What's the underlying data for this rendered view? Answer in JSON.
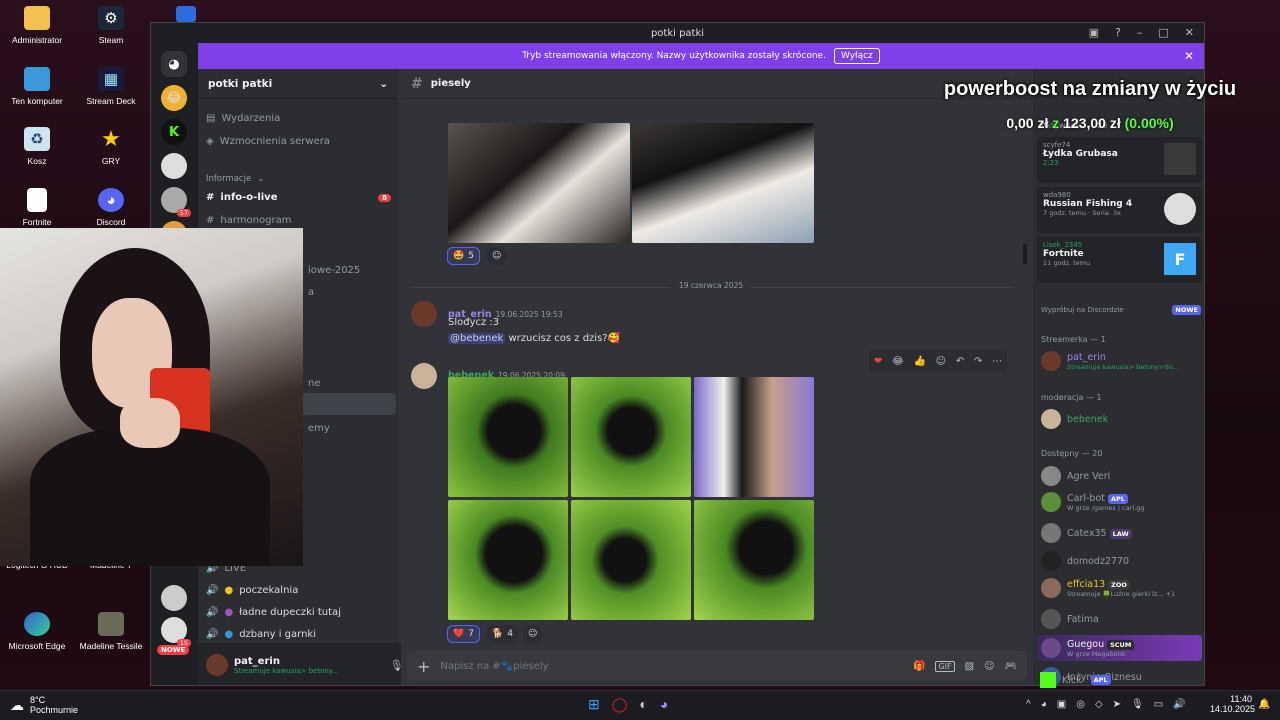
{
  "desktop": {
    "icons": [
      {
        "label": "Administrator",
        "icon": "folder-icon"
      },
      {
        "label": "Steam",
        "icon": "steam-icon"
      },
      {
        "label": "Ten komputer",
        "icon": "computer-icon"
      },
      {
        "label": "Stream Deck",
        "icon": "streamdeck-icon"
      },
      {
        "label": "Kosz",
        "icon": "recycle-bin-icon"
      },
      {
        "label": "GRY",
        "icon": "star-icon"
      },
      {
        "label": "Fortnite",
        "icon": "file-icon"
      },
      {
        "label": "Discord",
        "icon": "discord-icon"
      },
      {
        "label": "Logitech G HUB",
        "icon": "logitech-icon"
      },
      {
        "label": "Madeline T",
        "icon": "game-icon"
      },
      {
        "label": "Microsoft Edge",
        "icon": "edge-icon"
      },
      {
        "label": "Madeline Tessile",
        "icon": "game-icon"
      }
    ]
  },
  "window": {
    "title": "potki patki"
  },
  "banner": {
    "text": "Tryb streamowania włączony. Nazwy użytkownika zostały skrócone.",
    "button": "Wyłącz"
  },
  "guilds": {
    "badge_57": "57",
    "badge_15": "15",
    "new_label": "NOWE"
  },
  "server": {
    "name": "potki patki"
  },
  "channels": {
    "events": "Wydarzenia",
    "boosts": "Wzmocnienia serwera",
    "category_info": "Informacje",
    "info_live": "info-o-live",
    "info_live_badge": "8",
    "harmonogram": "harmonogram",
    "partial_1": "iowe-2025",
    "partial_2": "a",
    "partial_3": "ne",
    "partial_4": "emy",
    "live": "LIVE",
    "voice_1": "poczekalnia",
    "voice_2": "ładne dupeczki tutaj",
    "voice_3": "dzbany i garnki"
  },
  "user": {
    "name": "pat_erin",
    "status": "Streamuje kawusia> betony..."
  },
  "chat": {
    "channel": "piesely",
    "date_divider": "19 czerwca 2025",
    "reactions_top": [
      {
        "emoji": "🤩",
        "count": "5"
      }
    ],
    "messages": [
      {
        "author": "pat_erin",
        "time": "19.06.2025 19:53",
        "lines": [
          "Slodycz :3"
        ],
        "mention": "@bebenek",
        "mention_text": "wrzucisz cos z dzis?🥰"
      },
      {
        "author": "bebenek",
        "time": "19.06.2025 20:09"
      }
    ],
    "reactions_bottom": [
      {
        "emoji": "❤️",
        "count": "7"
      },
      {
        "emoji": "🐕",
        "count": "4"
      }
    ],
    "composer_placeholder": "Napisz na #🐾piesely"
  },
  "overlay": {
    "title": "powerboost na zmiany w życiu",
    "amount": "0,00 zł",
    "of": "z",
    "goal": "123,00 zł",
    "percent": "(0.00%)"
  },
  "members": {
    "activity_header": "Aktywność — 26",
    "activities": [
      {
        "user": "scyfe74",
        "game": "Łydka Grubasa",
        "detail": "2:23"
      },
      {
        "user": "wda980",
        "game": "Russian Fishing 4",
        "detail": "7 godz. temu",
        "detail2": "Seria: 3x"
      },
      {
        "user": "Lisek_2345",
        "game": "Fortnite",
        "detail": "11 godz. temu"
      }
    ],
    "try_discord": "Wypróbuj na Discordzie",
    "try_badge": "NOWE",
    "sec_streamer": "Streamerka — 1",
    "streamer": {
      "name": "pat_erin",
      "sub": "Streamuje kawusia> betony>tło..."
    },
    "sec_mod": "moderacja — 1",
    "mod": {
      "name": "bebenek"
    },
    "sec_online": "Dostępny — 20",
    "online": [
      {
        "name": "Agre Veri",
        "sub": "",
        "tag": ""
      },
      {
        "name": "Carl-bot",
        "sub": "W grze /games | carl.gg",
        "tag": "APL"
      },
      {
        "name": "Catex35",
        "sub": "",
        "tag": "LAW"
      },
      {
        "name": "domodz2770",
        "sub": "",
        "tag": ""
      },
      {
        "name": "effcia13",
        "sub": "Streamuje 🍀Luźne gierki lz... +1",
        "tag": "ZOO"
      },
      {
        "name": "Fatima",
        "sub": "",
        "tag": ""
      },
      {
        "name": "Guegou",
        "sub": "W grze Megabonk",
        "tag": "SCUM"
      },
      {
        "name": "InżynierBiznesu",
        "sub": "",
        "tag": ""
      },
      {
        "name": "Kick",
        "sub": "",
        "tag": "APL"
      }
    ]
  },
  "taskbar": {
    "weather_temp": "8°C",
    "weather_desc": "Pochmurnie",
    "time": "11:40",
    "date": "14.10.2025"
  }
}
